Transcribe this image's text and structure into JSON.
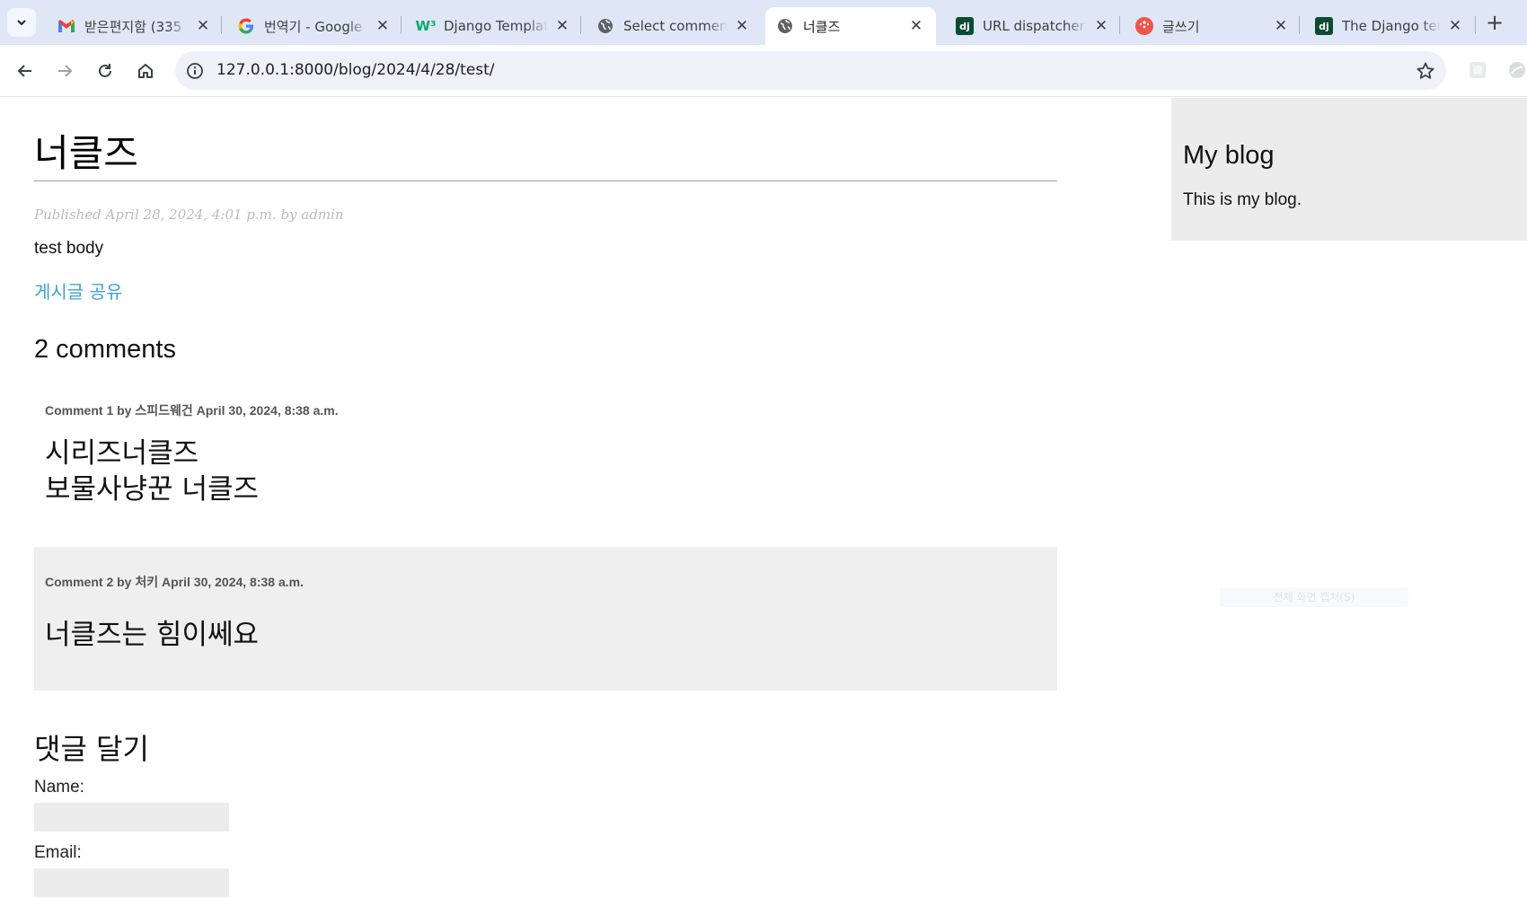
{
  "browser": {
    "tabs": [
      {
        "title": "받은편지함 (335",
        "favicon": "gmail-icon",
        "active": false
      },
      {
        "title": "번역기 - Google",
        "favicon": "google-icon",
        "active": false
      },
      {
        "title": "Django Templat",
        "favicon": "w3schools-icon",
        "active": false
      },
      {
        "title": "Select comment",
        "favicon": "globe-icon",
        "active": false
      },
      {
        "title": "너클즈",
        "favicon": "globe-icon",
        "active": true
      },
      {
        "title": "URL dispatcher",
        "favicon": "django-icon",
        "active": false
      },
      {
        "title": "글쓰기",
        "favicon": "tistory-icon",
        "active": false
      },
      {
        "title": "The Django tem",
        "favicon": "django-icon",
        "active": false
      }
    ],
    "favicon_text": {
      "django": "dj",
      "w3schools": "W³"
    },
    "url": "127.0.0.1:8000/blog/2024/4/28/test/"
  },
  "post": {
    "title": "너클즈",
    "date_line": "Published April 28, 2024, 4:01 p.m. by admin",
    "body": "test body",
    "share_label": "게시글 공유"
  },
  "comments": {
    "heading": "2 comments",
    "items": [
      {
        "info": "Comment 1 by 스피드웨건 April 30, 2024, 8:38 a.m.",
        "text": "시리즈너클즈\n보물사냥꾼 너클즈"
      },
      {
        "info": "Comment 2 by 처키 April 30, 2024, 8:38 a.m.",
        "text": "너클즈는 힘이쎄요"
      }
    ]
  },
  "form": {
    "heading": "댓글 달기",
    "fields": [
      {
        "label": "Name:",
        "value": ""
      },
      {
        "label": "Email:",
        "value": ""
      }
    ]
  },
  "sidebar": {
    "title": "My blog",
    "text": "This is my blog."
  },
  "overlay": {
    "capture_tip": "전체 화면 캡처(S)"
  },
  "colors": {
    "tabstrip": "#dfe6f6",
    "link": "#3da3d8",
    "comment_even_bg": "#efefef",
    "sidebar_bg": "#ececec"
  }
}
